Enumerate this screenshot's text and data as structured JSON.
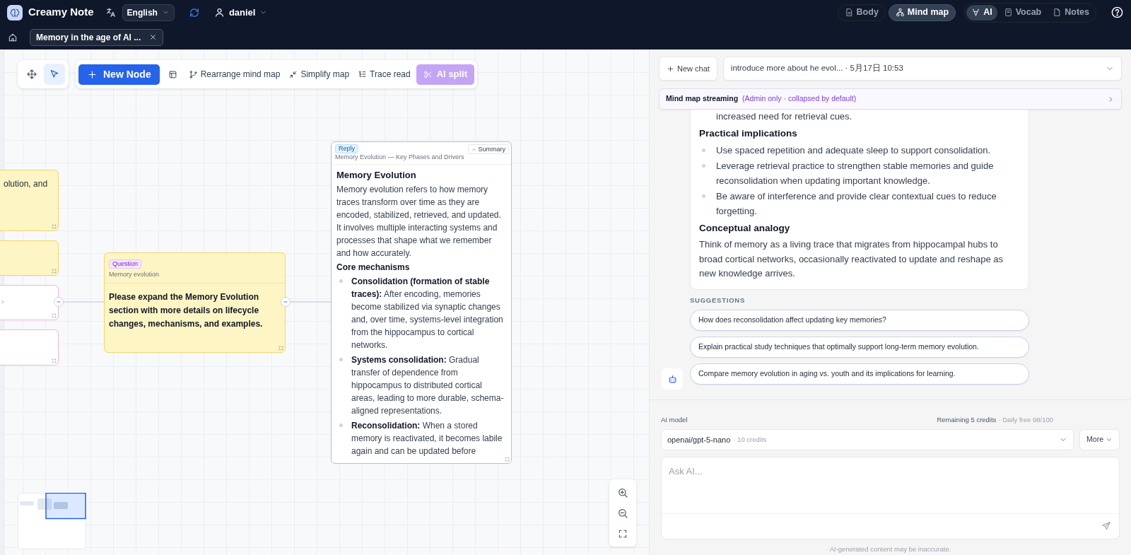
{
  "app": {
    "name": "Creamy Note",
    "language": "English",
    "user": "daniel"
  },
  "view_tabs": [
    {
      "label": "Body",
      "selected": false
    },
    {
      "label": "Mind map",
      "selected": true
    }
  ],
  "panel_tabs": [
    {
      "label": "AI",
      "selected": true
    },
    {
      "label": "Vocab",
      "selected": false
    },
    {
      "label": "Notes",
      "selected": false
    }
  ],
  "document_tab": {
    "title": "Memory in the age of AI ..."
  },
  "toolbar": {
    "tools": [
      {
        "kind": "pan",
        "selected": false
      },
      {
        "kind": "select",
        "selected": true
      }
    ],
    "actions": [
      {
        "kind": "primary",
        "label": "New Node"
      },
      {
        "kind": "icon"
      },
      {
        "kind": "plain",
        "label": "Rearrange mind map"
      },
      {
        "kind": "plain",
        "label": "Simplify map"
      },
      {
        "kind": "plain",
        "label": "Trace read"
      },
      {
        "kind": "ai",
        "label": "AI split"
      }
    ]
  },
  "nodes": [
    {
      "kind": "note",
      "text": "olution, and"
    },
    {
      "kind": "note"
    },
    {
      "kind": "empty"
    },
    {
      "kind": "empty"
    },
    {
      "kind": "question",
      "badge": "Question",
      "subtitle": "Memory evolution",
      "text": "Please expand the Memory Evolution section with more details on lifecycle changes, mechanisms, and examples."
    },
    {
      "kind": "reply",
      "badge": "Reply",
      "subtitle": "Memory Evolution — Key Phases and Drivers",
      "summary": "Summary",
      "heading": "Memory Evolution",
      "intro": "Memory evolution refers to how memory traces transform over time as they are encoded, stabilized, retrieved, and updated. It involves multiple interacting systems and processes that shape what we remember and how accurately.",
      "section": "Core mechanisms",
      "items": [
        "**Consolidation (formation of stable traces):** After encoding, memories become stabilized via synaptic changes and, over time, systems-level integration from the hippocampus to cortical networks.",
        "**Systems consolidation:** Gradual transfer of dependence from hippocampus to distributed cortical areas, leading to more durable, schema-aligned representations.",
        "**Reconsolidation:** When a stored memory is reactivated, it becomes labile again and can be updated before"
      ]
    }
  ],
  "chat": {
    "new_chat": "New chat",
    "conversation": "introduce more about he evol... · 5月17日 10:53",
    "streaming_title": "Mind map streaming",
    "streaming_note": "(Admin only · collapsed by default)",
    "message": [
      {
        "kind": "continuation",
        "text": "increased need for retrieval cues."
      },
      {
        "kind": "heading",
        "text": "Practical implications"
      },
      {
        "kind": "bullet",
        "text": "Use spaced repetition and adequate sleep to support consolidation."
      },
      {
        "kind": "bullet",
        "text": "Leverage retrieval practice to strengthen stable memories and guide reconsolidation when updating important knowledge."
      },
      {
        "kind": "bullet",
        "text": "Be aware of interference and provide clear contextual cues to reduce forgetting."
      },
      {
        "kind": "heading",
        "text": "Conceptual analogy"
      },
      {
        "kind": "paragraph",
        "text": "Think of memory as a living trace that migrates from hippocampal hubs to broad cortical networks, occasionally reactivated to update and reshape as new knowledge arrives."
      }
    ],
    "suggestions_label": "SUGGESTIONS",
    "suggestions": [
      "How does reconsolidation affect updating key memories?",
      "Explain practical study techniques that optimally support long-term memory evolution.",
      "Compare memory evolution in aging vs. youth and its implications for learning."
    ],
    "model_label": "AI model",
    "credits": "Remaining 5 credits",
    "daily": "· Daily free 98/100",
    "model": "openai/gpt-5-nano",
    "model_cost": "· 10 credits",
    "more": "More",
    "placeholder": "Ask AI...",
    "disclaimer": "AI-generated content may be inaccurate."
  }
}
